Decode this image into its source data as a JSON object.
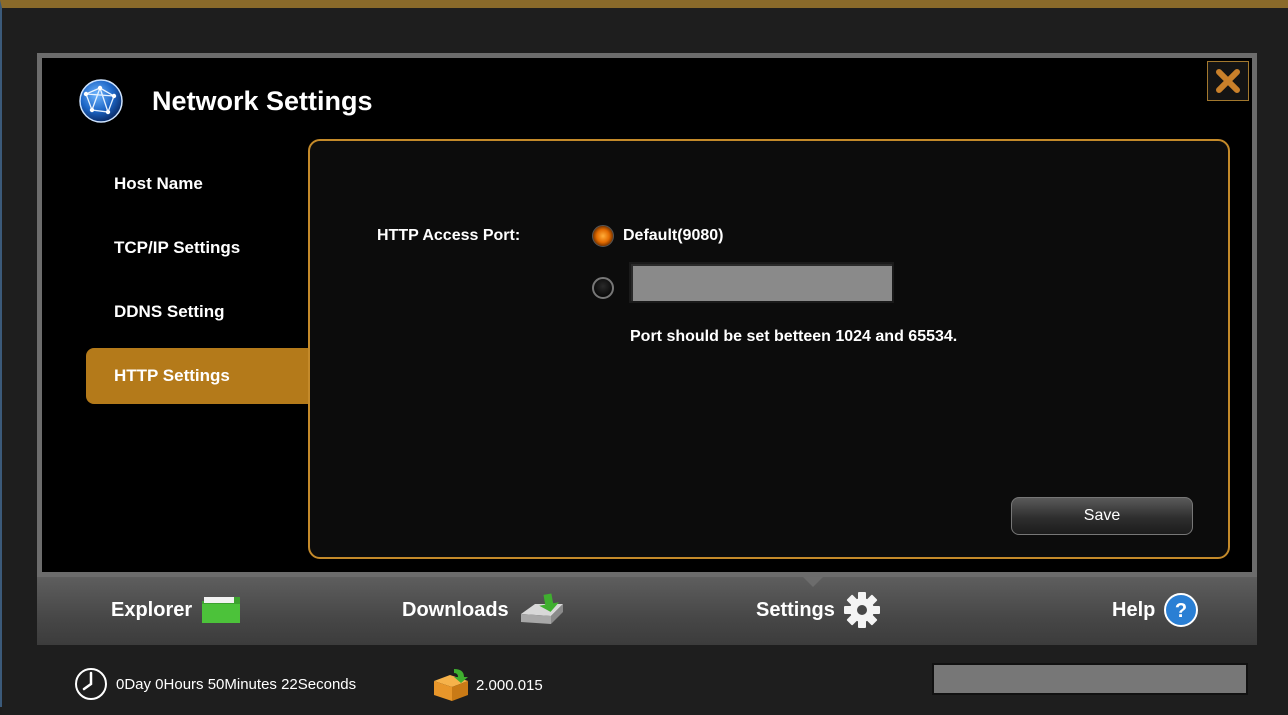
{
  "window": {
    "title": "Network Settings"
  },
  "sidebar": {
    "items": [
      {
        "label": "Host Name",
        "active": false
      },
      {
        "label": "TCP/IP Settings",
        "active": false
      },
      {
        "label": "DDNS Setting",
        "active": false
      },
      {
        "label": "HTTP Settings",
        "active": true
      }
    ]
  },
  "http": {
    "port_label": "HTTP Access Port:",
    "default_option_label": "Default(9080)",
    "default_selected": true,
    "custom_port_value": "",
    "hint": "Port should be set betteen 1024 and 65534.",
    "save_label": "Save"
  },
  "nav": {
    "items": [
      {
        "label": "Explorer",
        "icon": "folder-icon"
      },
      {
        "label": "Downloads",
        "icon": "download-drive-icon"
      },
      {
        "label": "Settings",
        "icon": "gear-icon",
        "active": true
      },
      {
        "label": "Help",
        "icon": "help-icon"
      }
    ]
  },
  "status": {
    "uptime": "0Day 0Hours 50Minutes 22Seconds",
    "version": "2.000.015",
    "progress": 0
  },
  "colors": {
    "accent": "#b47a1a",
    "panel_border": "#c48a2a",
    "help_blue": "#2a7fd4"
  }
}
